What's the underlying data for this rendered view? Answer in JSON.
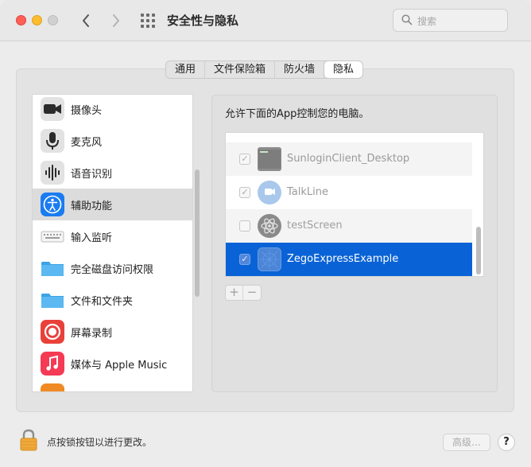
{
  "window": {
    "title": "安全性与隐私",
    "search_placeholder": "搜索"
  },
  "tabs": [
    {
      "label": "通用"
    },
    {
      "label": "文件保险箱"
    },
    {
      "label": "防火墙"
    },
    {
      "label": "隐私",
      "active": true
    }
  ],
  "sidebar": {
    "items": [
      {
        "label": "摄像头",
        "icon": "camera-icon"
      },
      {
        "label": "麦克风",
        "icon": "microphone-icon"
      },
      {
        "label": "语音识别",
        "icon": "waveform-icon"
      },
      {
        "label": "辅助功能",
        "icon": "accessibility-icon",
        "selected": true
      },
      {
        "label": "输入监听",
        "icon": "keyboard-icon"
      },
      {
        "label": "完全磁盘访问权限",
        "icon": "folder-icon"
      },
      {
        "label": "文件和文件夹",
        "icon": "folder-icon"
      },
      {
        "label": "屏幕录制",
        "icon": "screen-record-icon"
      },
      {
        "label": "媒体与 Apple Music",
        "icon": "music-icon"
      }
    ]
  },
  "content": {
    "description": "允许下面的App控制您的电脑。",
    "apps": [
      {
        "name": "SunloginClient_Desktop",
        "checked": true
      },
      {
        "name": "TalkLine",
        "checked": true
      },
      {
        "name": "testScreen",
        "checked": false
      },
      {
        "name": "ZegoExpressExample",
        "checked": true,
        "selected": true
      }
    ],
    "add_symbol": "+",
    "remove_symbol": "−"
  },
  "footer": {
    "lock_text": "点按锁按钮以进行更改。",
    "advanced_label": "高级…",
    "help_label": "?"
  },
  "colors": {
    "selection_blue": "#0a63d6",
    "close": "#fe5f57",
    "minimize": "#febc2e"
  }
}
